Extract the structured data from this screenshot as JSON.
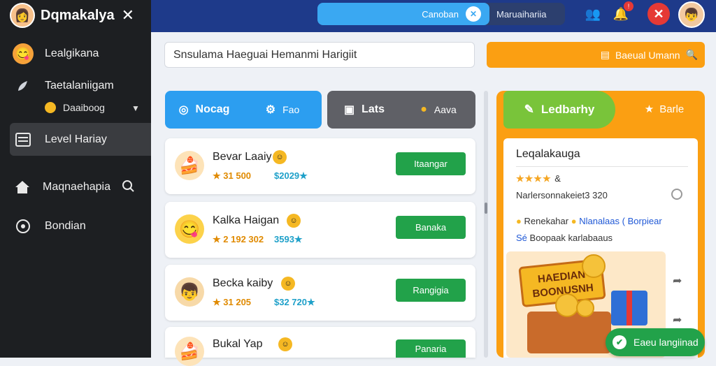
{
  "app": {
    "title": "Dqmakalya",
    "close_glyph": "✕"
  },
  "sidebar": {
    "items": [
      {
        "label": "Lealgikana",
        "icon": "trophy-icon"
      },
      {
        "label": "Taetalaniigam",
        "icon": "rocket-icon"
      },
      {
        "label": "Level Hariay",
        "icon": "list-icon",
        "active": true
      },
      {
        "label": "Maqnaehapia",
        "icon": "home-icon"
      },
      {
        "label": "Bondian",
        "icon": "settings-icon"
      }
    ],
    "sub_item": {
      "label": "Daaiboog"
    }
  },
  "topbar": {
    "pill_left": "Canoban",
    "pill_right": "Maruaihariia",
    "notification_count": "!"
  },
  "search": {
    "value": "Snsulama Haeguai Hemanmi Harigiit"
  },
  "orange_button": {
    "label": "Baeual Umann"
  },
  "tabs": [
    {
      "left": "Nocag",
      "right": "Fao",
      "color": "#2c9ef0"
    },
    {
      "left": "Lats",
      "right": "Aava",
      "color": "#5f6066"
    }
  ],
  "cards": [
    {
      "name": "Bevar Laaiy",
      "value1": "★ 31 500",
      "value2": "$2029★",
      "action": "Itaangar",
      "emoji": "🍰"
    },
    {
      "name": "Kalka Haigan",
      "value1": "★ 2 192 302",
      "value2": "3593★",
      "action": "Banaka",
      "emoji": "😋"
    },
    {
      "name": "Becka kaiby",
      "value1": "★ 31 205",
      "value2": "$32 720★",
      "action": "Rangigia",
      "emoji": "👦"
    },
    {
      "name": "Bukal Yap",
      "value1": "",
      "value2": "",
      "action": "Panaria",
      "emoji": "🍰"
    }
  ],
  "panel": {
    "tab_active": "Ledbarhy",
    "tab_other": "Barle",
    "title": "Leqalakauga",
    "stars": "★★★★",
    "stars_suffix": "&",
    "line1": "Narlersonnakeiet3 320",
    "line2a": "Renekahar",
    "line2b": "Nlanalaas ( Borpiear",
    "line3a": "Sé",
    "line3b": "Boopaak karlabaaus",
    "promo_text": "HAEDIAN BOONUSNH"
  },
  "fab": {
    "label": "Eaeu langiinad"
  },
  "colors": {
    "green": "#22a24a",
    "orange": "#fb9f12",
    "blue": "#2c9ef0",
    "topbar": "#1e3a8a"
  }
}
